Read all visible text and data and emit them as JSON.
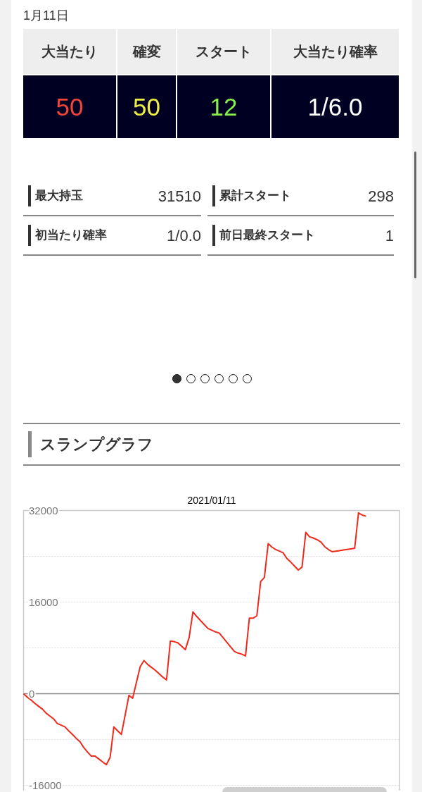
{
  "date": "1月11日",
  "summary_table": {
    "columns": [
      "大当たり",
      "確変",
      "スタート",
      "大当たり確率"
    ],
    "values": [
      {
        "text": "50",
        "color": "#f2443a"
      },
      {
        "text": "50",
        "color": "#eeee44"
      },
      {
        "text": "12",
        "color": "#88f04c"
      },
      {
        "text": "1/6.0",
        "color": "#ffffff"
      }
    ]
  },
  "stats": [
    {
      "label": "最大持玉",
      "value": "31510"
    },
    {
      "label": "累計スタート",
      "value": "298"
    },
    {
      "label": "初当たり確率",
      "value": "1/0.0"
    },
    {
      "label": "前日最終スタート",
      "value": "1"
    }
  ],
  "pager": {
    "dots": [
      {
        "selected": true
      },
      {
        "selected": false
      },
      {
        "selected": false
      },
      {
        "selected": false
      },
      {
        "selected": false
      },
      {
        "selected": false
      }
    ]
  },
  "slump_graph": {
    "heading": "スランプグラフ",
    "chart_data": {
      "type": "line",
      "title": "2021/01/11",
      "categories": [
        null,
        null,
        null,
        null,
        null,
        null,
        null,
        null,
        null,
        null,
        null,
        null,
        null,
        null,
        null,
        null,
        null,
        null,
        null,
        null,
        null,
        null,
        null,
        null,
        null,
        null,
        null,
        null,
        null,
        null,
        null,
        null,
        null,
        null,
        null,
        null,
        null,
        null,
        null,
        null,
        null,
        null,
        null,
        null,
        null,
        null,
        null,
        null,
        null,
        null,
        null,
        null,
        null,
        null,
        null,
        null,
        null,
        null,
        null,
        null,
        null,
        null,
        null,
        null,
        null,
        null,
        null,
        null,
        null,
        null,
        null,
        null,
        null,
        null,
        null,
        null,
        null,
        null,
        null,
        null,
        null,
        null,
        null,
        null,
        null,
        null,
        null,
        null,
        null,
        null,
        null,
        null,
        null,
        null,
        null,
        null,
        null,
        null,
        null,
        null,
        null
      ],
      "series": [
        {
          "color": "#ee2a1c",
          "values": [
            0,
            -600,
            -1100,
            -1700,
            -2200,
            -2700,
            -3400,
            -3900,
            -4400,
            -5200,
            -5500,
            -5800,
            -6500,
            -7100,
            -7800,
            -8400,
            -9400,
            -10200,
            -10900,
            -10900,
            -11400,
            -11900,
            -12400,
            -11100,
            -5800,
            -6500,
            -7100,
            -3700,
            -300,
            -800,
            2000,
            4700,
            5800,
            5100,
            4600,
            4100,
            3500,
            2900,
            2400,
            9200,
            9100,
            8900,
            8300,
            7700,
            9800,
            14300,
            13500,
            12800,
            12100,
            11400,
            11100,
            10800,
            10600,
            9800,
            9000,
            8200,
            7400,
            7100,
            6900,
            6600,
            13200,
            13200,
            13600,
            19600,
            20300,
            26200,
            25600,
            25200,
            24900,
            24600,
            23600,
            23000,
            22300,
            21600,
            22100,
            28200,
            27400,
            27200,
            26900,
            26500,
            25700,
            25200,
            24800,
            24900,
            25000,
            25100,
            25200,
            25300,
            25400,
            31600,
            31200,
            31000,
            null,
            null,
            null,
            null,
            null,
            null,
            null,
            null,
            null
          ]
        }
      ],
      "ylim": [
        -16000,
        32000
      ],
      "yticks": [
        32000,
        16000,
        0,
        -16000
      ]
    }
  }
}
